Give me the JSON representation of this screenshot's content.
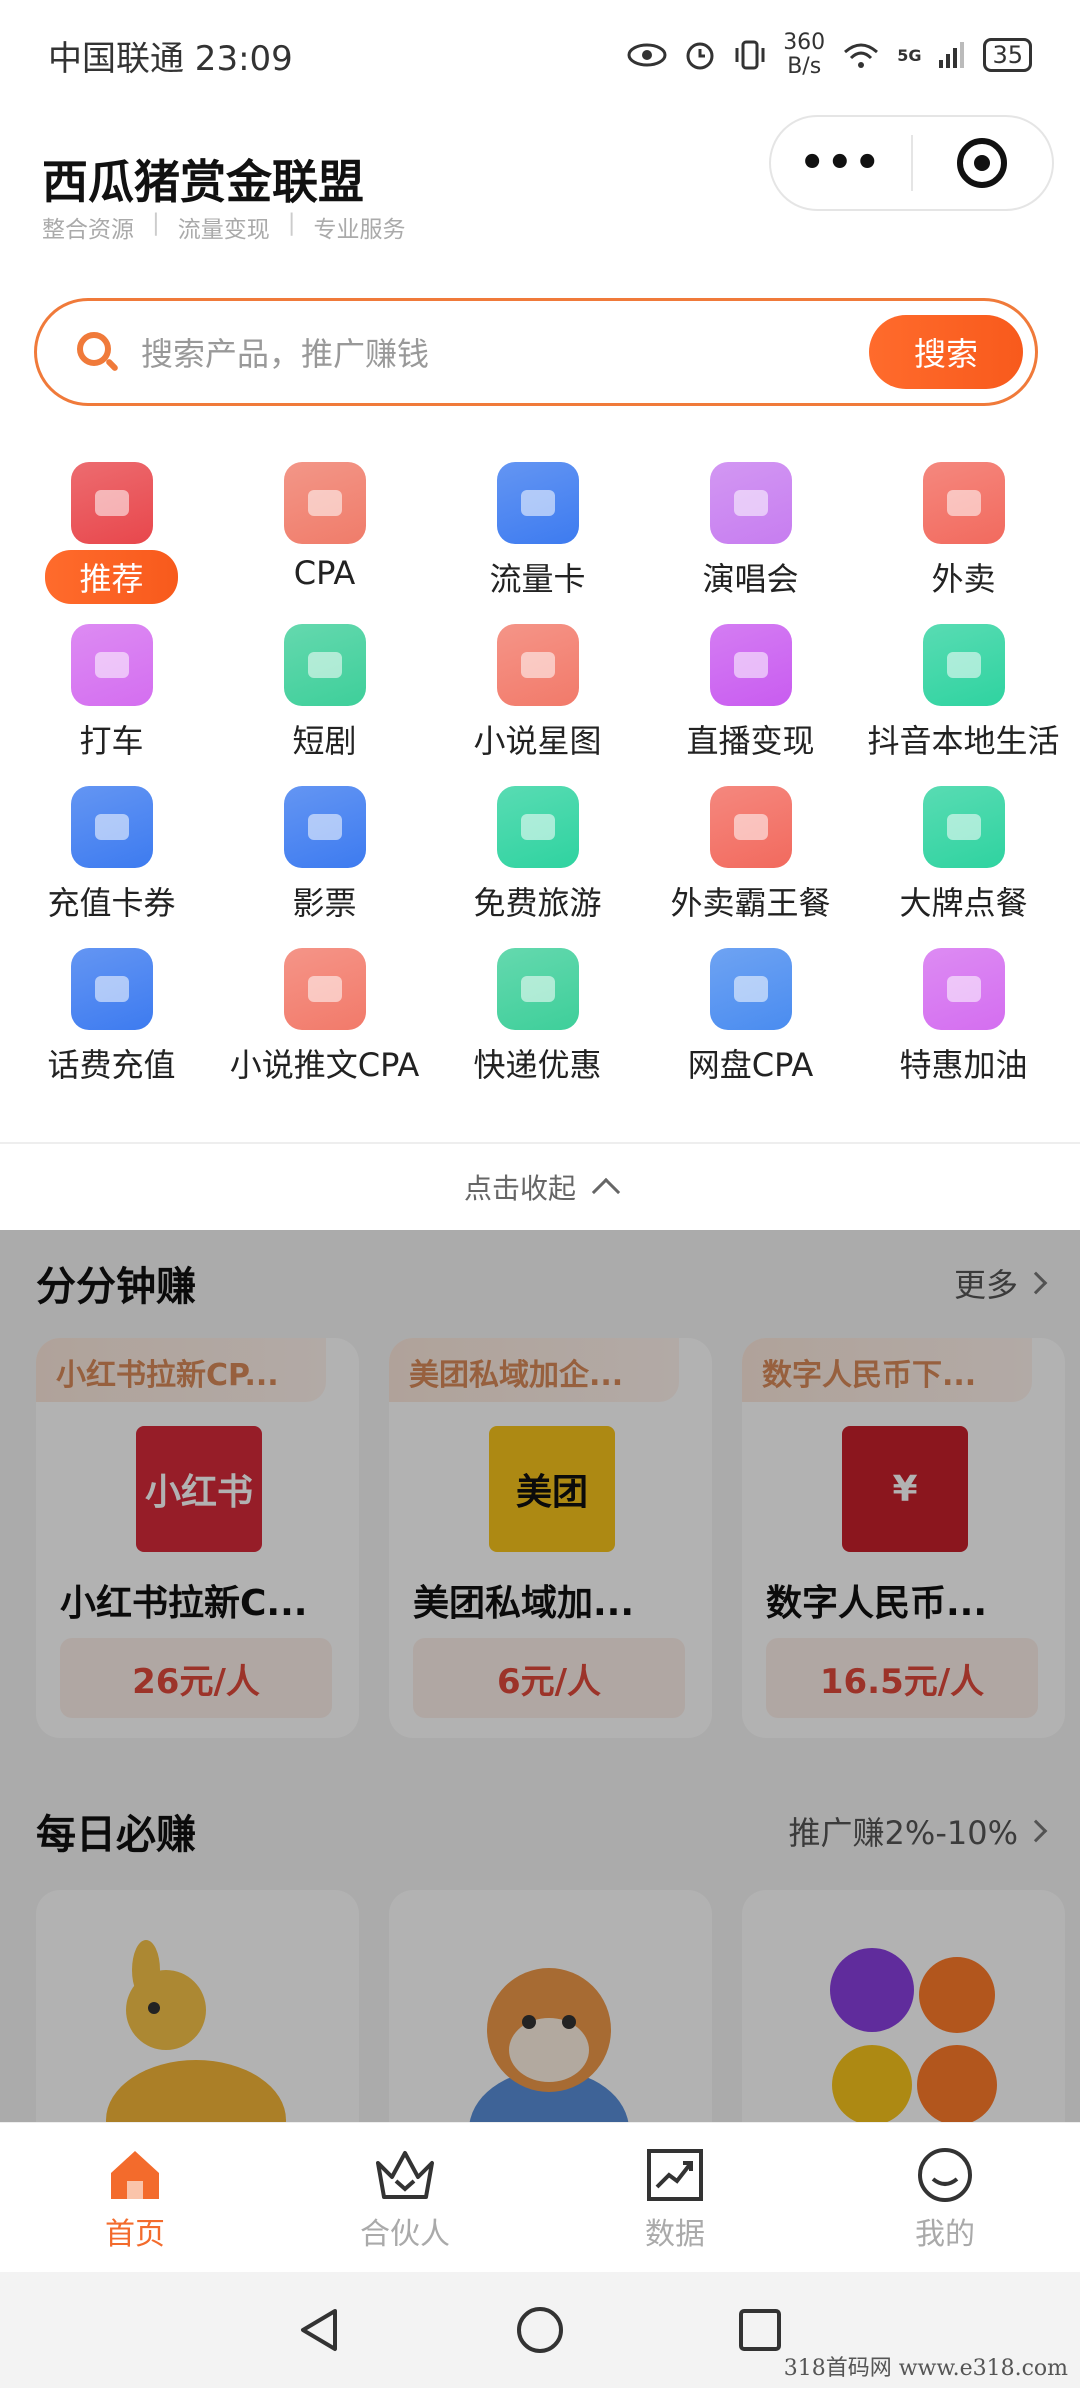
{
  "status_bar": {
    "carrier_time": "中国联通 23:09",
    "net_speed_value": "360",
    "net_speed_unit": "B/s",
    "signal_label": "5G",
    "battery": "35"
  },
  "header": {
    "title": "西瓜猪赏金联盟",
    "tagline": [
      "整合资源",
      "流量变现",
      "专业服务"
    ],
    "more_label": "•••"
  },
  "search": {
    "placeholder": "搜索产品，推广赚钱",
    "button_label": "搜索"
  },
  "grid": [
    {
      "label": "推荐",
      "icon": "bookmark-star-icon",
      "color": "#e8474c"
    },
    {
      "label": "CPA",
      "icon": "user-add-icon",
      "color": "#f07c6a"
    },
    {
      "label": "流量卡",
      "icon": "sim-card-icon",
      "color": "#3d7bf0"
    },
    {
      "label": "演唱会",
      "icon": "microphone-icon",
      "color": "#c77df0"
    },
    {
      "label": "外卖",
      "icon": "food-box-icon",
      "color": "#f26a5e"
    },
    {
      "label": "打车",
      "icon": "taxi-icon",
      "color": "#d46ef0"
    },
    {
      "label": "短剧",
      "icon": "tv-play-icon",
      "color": "#3ecf9a"
    },
    {
      "label": "小说星图",
      "icon": "book-icon",
      "color": "#f27a6a"
    },
    {
      "label": "直播变现",
      "icon": "live-video-icon",
      "color": "#c95cf0"
    },
    {
      "label": "抖音本地生活",
      "icon": "tiktok-cup-icon",
      "color": "#2fd3a0"
    },
    {
      "label": "充值卡券",
      "icon": "coupon-icon",
      "color": "#3d7bf0"
    },
    {
      "label": "影票",
      "icon": "film-reel-icon",
      "color": "#3d7bf0"
    },
    {
      "label": "免费旅游",
      "icon": "airplane-icon",
      "color": "#2fd3a0"
    },
    {
      "label": "外卖霸王餐",
      "icon": "dish-cover-icon",
      "color": "#f26a5e"
    },
    {
      "label": "大牌点餐",
      "icon": "chef-hat-icon",
      "color": "#2fd3a0"
    },
    {
      "label": "话费充值",
      "icon": "phone-yuan-icon",
      "color": "#3d7bf0"
    },
    {
      "label": "小说推文CPA",
      "icon": "book-open-icon",
      "color": "#f27a6a"
    },
    {
      "label": "快递优惠",
      "icon": "package-icon",
      "color": "#3ecf9a"
    },
    {
      "label": "网盘CPA",
      "icon": "cloud-icon",
      "color": "#4a8cf0"
    },
    {
      "label": "特惠加油",
      "icon": "fuel-pump-icon",
      "color": "#d46ef0"
    }
  ],
  "collapse_label": "点击收起",
  "quick_earn": {
    "title": "分分钟赚",
    "more": "更多",
    "cards": [
      {
        "tag": "小红书拉新CP...",
        "logo_text": "小红书",
        "logo_bg": "#d72a3a",
        "logo_color": "#ffffff",
        "name": "小红书拉新C...",
        "price": "26元/人"
      },
      {
        "tag": "美团私域加企...",
        "logo_text": "美团",
        "logo_bg": "#f8c51c",
        "logo_color": "#111111",
        "name": "美团私域加...",
        "price": "6元/人"
      },
      {
        "tag": "数字人民币下...",
        "logo_text": "¥",
        "logo_bg": "#c8202c",
        "logo_color": "#ffffff",
        "name": "数字人民币...",
        "price": "16.5元/人"
      }
    ]
  },
  "daily_earn": {
    "title": "每日必赚",
    "more": "推广赚2%-10%"
  },
  "tabs": [
    {
      "label": "首页",
      "icon": "home-icon",
      "active": true
    },
    {
      "label": "合伙人",
      "icon": "crown-icon",
      "active": false
    },
    {
      "label": "数据",
      "icon": "chart-icon",
      "active": false
    },
    {
      "label": "我的",
      "icon": "smile-icon",
      "active": false
    }
  ],
  "watermark": "318首码网  www.e318.com"
}
